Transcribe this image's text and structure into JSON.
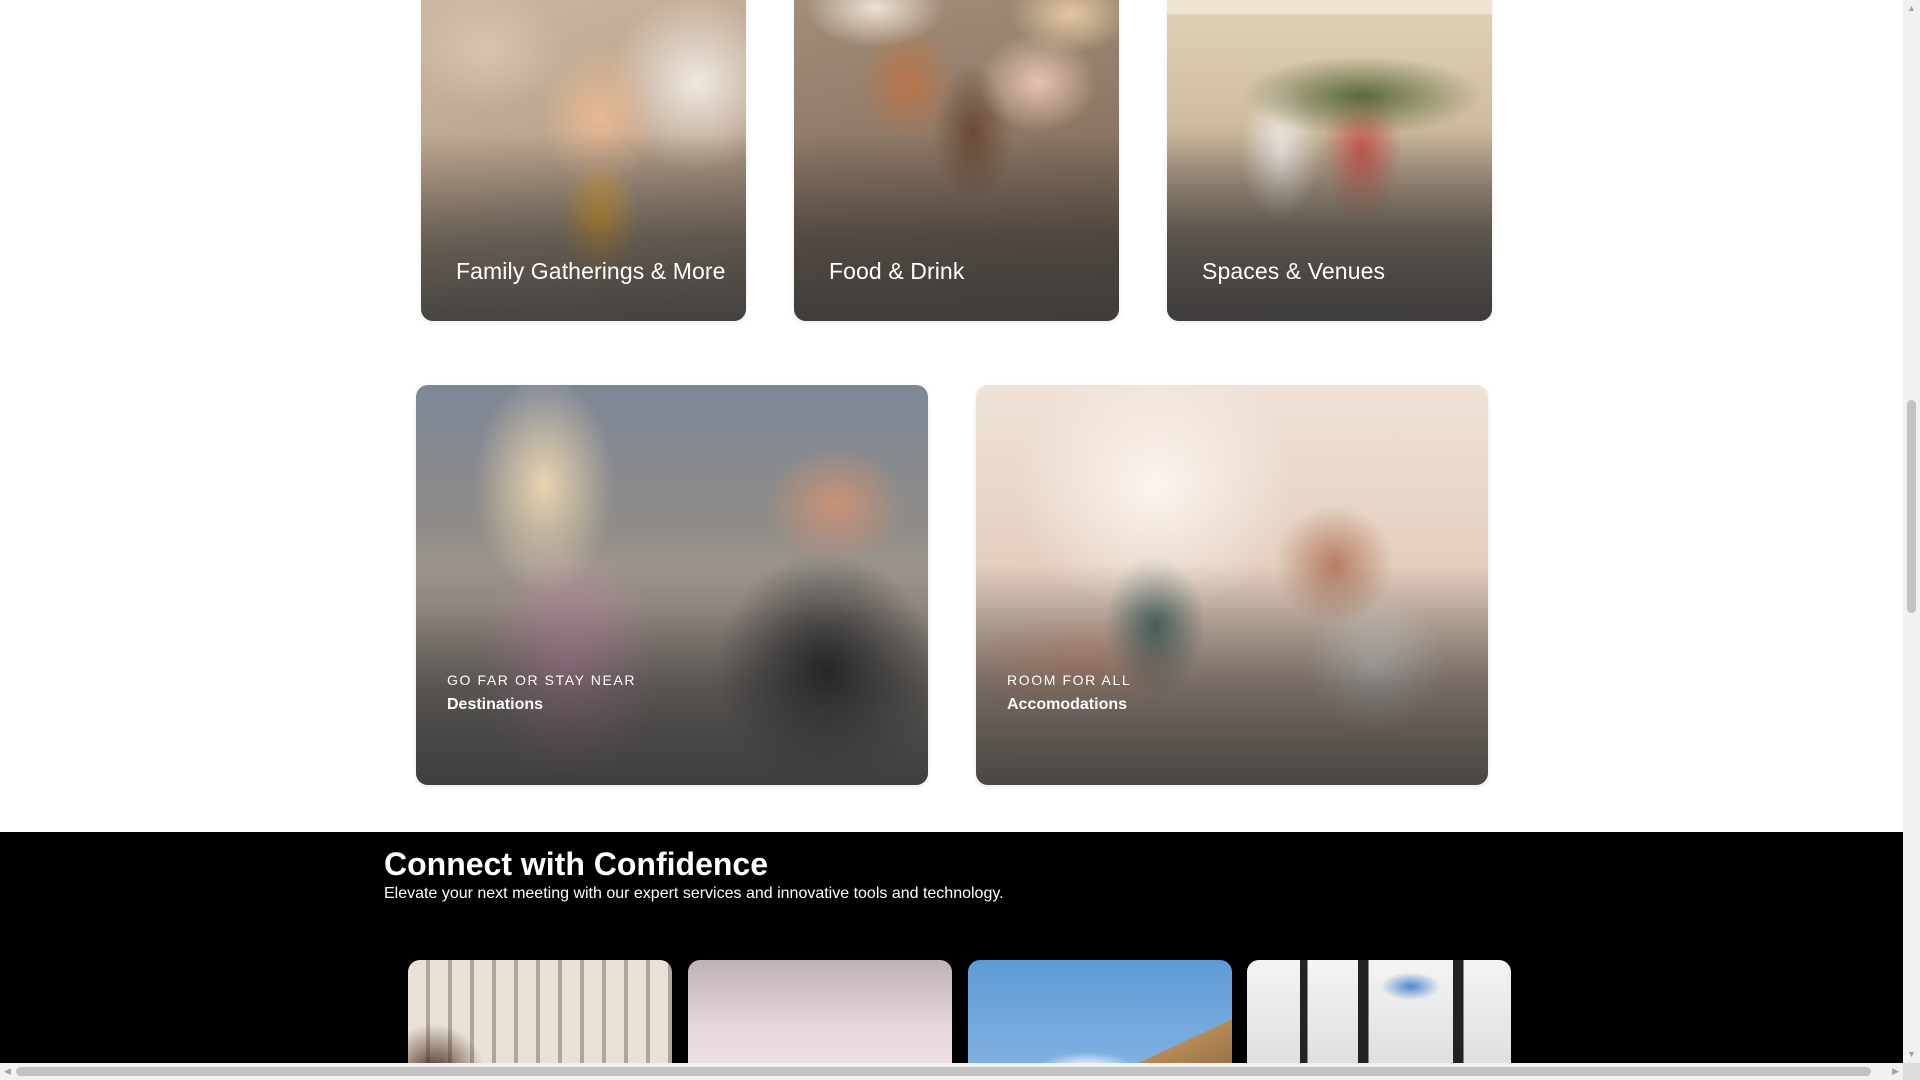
{
  "categories_top": [
    {
      "label": "Family Gatherings & More"
    },
    {
      "label": "Food & Drink"
    },
    {
      "label": "Spaces & Venues"
    }
  ],
  "features": [
    {
      "overline": "GO FAR OR STAY NEAR",
      "title": "Destinations"
    },
    {
      "overline": "ROOM FOR ALL",
      "title": "Accomodations"
    }
  ],
  "connect": {
    "heading": "Connect with Confidence",
    "subheading": "Elevate your next meeting with our expert services and innovative tools and technology."
  },
  "scrollbars": {
    "vertical_position": 0.4,
    "horizontal_position": 0.0
  }
}
